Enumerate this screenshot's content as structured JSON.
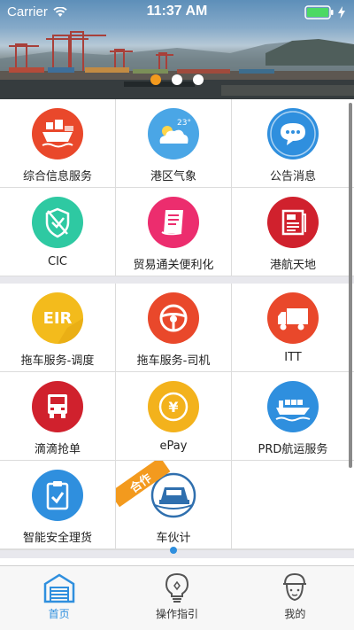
{
  "status_bar": {
    "carrier": "Carrier",
    "time": "11:37 AM"
  },
  "banner": {
    "slides": 3,
    "active_slide": 1
  },
  "grid": {
    "sections": [
      {
        "rows": [
          [
            {
              "label": "综合信息服务",
              "icon": "ship-cargo-icon",
              "color": "#e9482b"
            },
            {
              "label": "港区气象",
              "icon": "weather-cloud-icon",
              "color": "#4aa6e6",
              "temp": "23°"
            },
            {
              "label": "公告消息",
              "icon": "chat-bubble-icon",
              "color": "#2f8fde"
            }
          ],
          [
            {
              "label": "CIC",
              "icon": "cic-shield-icon",
              "color": "#2ec9a2"
            },
            {
              "label": "贸易通关便利化",
              "icon": "document-icon",
              "color": "#ec2d6e"
            },
            {
              "label": "港航天地",
              "icon": "newspaper-icon",
              "color": "#d0212d"
            }
          ]
        ]
      },
      {
        "rows": [
          [
            {
              "label": "拖车服务-调度",
              "icon": "eir-badge-icon",
              "color": "#f3bb1c",
              "badge": "EIR"
            },
            {
              "label": "拖车服务-司机",
              "icon": "steering-wheel-icon",
              "color": "#e9482b"
            },
            {
              "label": "ITT",
              "icon": "truck-icon",
              "color": "#e9482b"
            }
          ],
          [
            {
              "label": "滴滴抢单",
              "icon": "truck-front-icon",
              "color": "#d0212d"
            },
            {
              "label": "ePay",
              "icon": "yen-coin-icon",
              "color": "#f3b21c",
              "symbol": "¥"
            },
            {
              "label": "PRD航运服务",
              "icon": "cargo-ship-icon",
              "color": "#2f8fde"
            }
          ],
          [
            {
              "label": "智能安全理货",
              "icon": "clipboard-check-icon",
              "color": "#2f8fde"
            },
            {
              "label": "车伙计",
              "icon": "bus-logo-icon",
              "color": "#2f6fae",
              "ribbon": "合作"
            },
            {
              "label": "",
              "icon": "",
              "color": ""
            }
          ]
        ]
      }
    ]
  },
  "tabbar": {
    "items": [
      {
        "label": "首页",
        "icon": "home-garage-icon",
        "active": true
      },
      {
        "label": "操作指引",
        "icon": "lightbulb-icon",
        "active": false
      },
      {
        "label": "我的",
        "icon": "user-cap-icon",
        "active": false
      }
    ],
    "accent": "#2f8fde"
  }
}
